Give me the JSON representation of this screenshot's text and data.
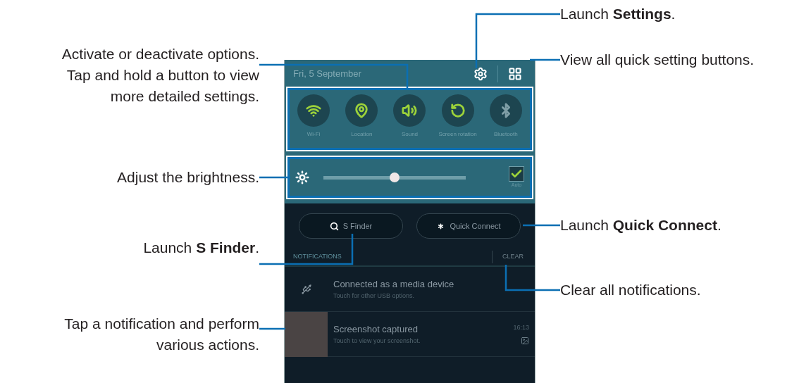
{
  "callouts_left": [
    {
      "text": "Activate or deactivate options. Tap and hold a button to view more detailed settings."
    },
    {
      "text": "Adjust the brightness."
    },
    {
      "text": "Launch **S Finder**."
    },
    {
      "text": "Tap a notification and perform various actions."
    }
  ],
  "callouts_right": [
    {
      "text": "Launch **Settings**."
    },
    {
      "text": "View all quick setting buttons."
    },
    {
      "text": "Launch **Quick Connect**."
    },
    {
      "text": "Clear all notifications."
    }
  ],
  "phone": {
    "date": "Fri, 5 September",
    "toggles": [
      {
        "kind": "wifi",
        "label": "Wi-Fi",
        "on": true
      },
      {
        "kind": "location",
        "label": "Location",
        "on": true
      },
      {
        "kind": "sound",
        "label": "Sound",
        "on": true
      },
      {
        "kind": "rotation",
        "label": "Screen rotation",
        "on": true
      },
      {
        "kind": "bluetooth",
        "label": "Bluetooth",
        "on": false
      }
    ],
    "brightness": {
      "level": 0.5,
      "auto_checked": true,
      "auto_label": "Auto"
    },
    "buttons": [
      {
        "kind": "finder",
        "label": "S Finder"
      },
      {
        "kind": "connect",
        "label": "Quick Connect"
      }
    ],
    "notifications_header": "NOTIFICATIONS",
    "clear": "CLEAR",
    "notifications": [
      {
        "kind": "usb",
        "title": "Connected as a media device",
        "subtitle": "Touch for other USB options."
      },
      {
        "kind": "screenshot",
        "title": "Screenshot captured",
        "subtitle": "Touch to view your screenshot.",
        "time": "16:13"
      }
    ]
  }
}
